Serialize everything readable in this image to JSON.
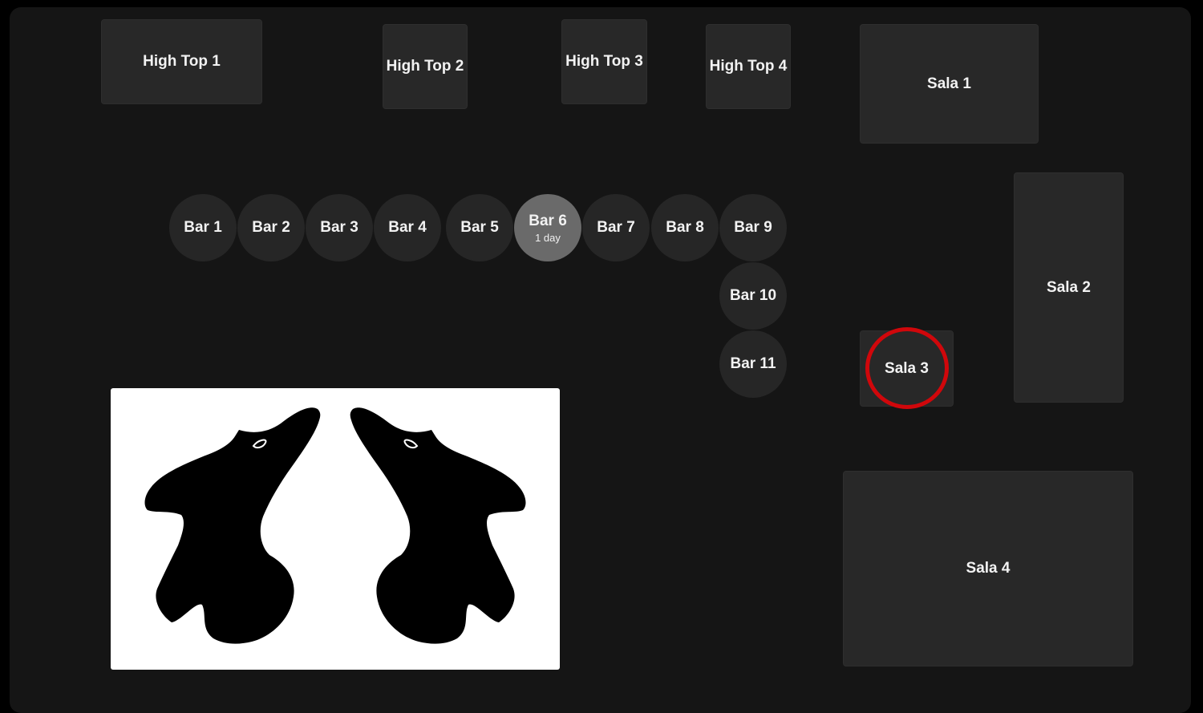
{
  "high_tops": [
    {
      "label": "High Top 1"
    },
    {
      "label": "High Top 2"
    },
    {
      "label": "High Top 3"
    },
    {
      "label": "High Top 4"
    }
  ],
  "salas": [
    {
      "label": "Sala 1"
    },
    {
      "label": "Sala 2"
    },
    {
      "label": "Sala 3"
    },
    {
      "label": "Sala 4"
    }
  ],
  "bars": [
    {
      "label": "Bar 1"
    },
    {
      "label": "Bar 2"
    },
    {
      "label": "Bar 3"
    },
    {
      "label": "Bar 4"
    },
    {
      "label": "Bar 5"
    },
    {
      "label": "Bar 6",
      "sub": "1 day",
      "active": true
    },
    {
      "label": "Bar 7"
    },
    {
      "label": "Bar 8"
    },
    {
      "label": "Bar 9"
    },
    {
      "label": "Bar 10"
    },
    {
      "label": "Bar 11"
    }
  ],
  "selected_table": "Sala 3",
  "colors": {
    "floor": "#151515",
    "table": "#282828",
    "active_bar": "#6a6a6a",
    "highlight": "#d0070b",
    "text": "#f2f2f2"
  },
  "logo_icon": "twin-bird-silhouettes-icon"
}
